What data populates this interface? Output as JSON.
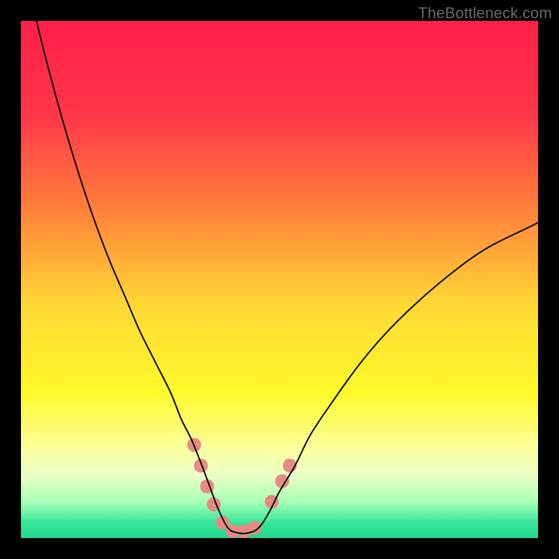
{
  "watermark": "TheBottleneck.com",
  "chart_data": {
    "type": "line",
    "title": "",
    "xlabel": "",
    "ylabel": "",
    "xlim": [
      0,
      100
    ],
    "ylim": [
      0,
      100
    ],
    "gradient_stops": [
      {
        "pos": 0.0,
        "color": "#ff1f4a"
      },
      {
        "pos": 0.18,
        "color": "#ff364a"
      },
      {
        "pos": 0.35,
        "color": "#ff7a3a"
      },
      {
        "pos": 0.55,
        "color": "#ffd836"
      },
      {
        "pos": 0.72,
        "color": "#fff92b"
      },
      {
        "pos": 0.83,
        "color": "#fbffa0"
      },
      {
        "pos": 0.88,
        "color": "#e9ffc5"
      },
      {
        "pos": 0.93,
        "color": "#a8ffb5"
      },
      {
        "pos": 0.97,
        "color": "#38e59a"
      },
      {
        "pos": 1.0,
        "color": "#1fd98f"
      }
    ],
    "series": [
      {
        "name": "bottleneck-curve",
        "color": "#000000",
        "stroke_width": 2,
        "x": [
          3,
          5,
          8,
          11,
          14,
          17,
          20,
          23,
          26,
          29,
          31,
          33,
          35,
          36.5,
          38,
          40,
          42,
          44,
          46,
          48,
          50,
          53,
          56,
          60,
          65,
          70,
          76,
          83,
          90,
          98,
          100
        ],
        "y": [
          100,
          92,
          81,
          71,
          62,
          54,
          47,
          40,
          34,
          28,
          23,
          19,
          14,
          10,
          6,
          2,
          1,
          1,
          2,
          5,
          9,
          14,
          20,
          26,
          33,
          39,
          45,
          51,
          56,
          60,
          61
        ]
      }
    ],
    "markers": {
      "name": "highlight-dots",
      "color": "#e58b84",
      "radius": 10,
      "points": [
        {
          "x": 33.5,
          "y": 18
        },
        {
          "x": 34.8,
          "y": 14
        },
        {
          "x": 36.0,
          "y": 10
        },
        {
          "x": 37.3,
          "y": 6.5
        },
        {
          "x": 39.0,
          "y": 3.0
        },
        {
          "x": 41.0,
          "y": 1.3
        },
        {
          "x": 43.2,
          "y": 1.3
        },
        {
          "x": 45.2,
          "y": 2.0
        },
        {
          "x": 48.5,
          "y": 7.0
        },
        {
          "x": 50.5,
          "y": 11.0
        },
        {
          "x": 52.0,
          "y": 14.0
        }
      ]
    }
  }
}
